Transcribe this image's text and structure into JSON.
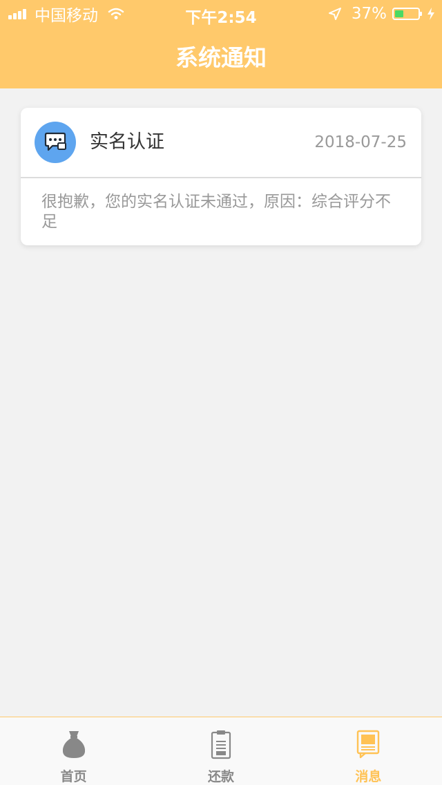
{
  "status_bar": {
    "carrier": "中国移动",
    "time": "下午2:54",
    "battery_percent": "37%",
    "battery_level": 0.37,
    "signal_bars": 4
  },
  "header": {
    "title": "系统通知"
  },
  "notifications": [
    {
      "icon": "message-icon",
      "title": "实名认证",
      "date": "2018-07-25",
      "body": "很抱歉，您的实名认证未通过，原因：综合评分不足"
    }
  ],
  "tabbar": {
    "items": [
      {
        "label": "首页",
        "icon": "money-bag-icon",
        "active": false
      },
      {
        "label": "还款",
        "icon": "clipboard-icon",
        "active": false
      },
      {
        "label": "消息",
        "icon": "message-book-icon",
        "active": true
      }
    ]
  },
  "colors": {
    "accent": "#ffc96b",
    "active_tab": "#ffc254",
    "avatar": "#5ea5ef",
    "battery_fill": "#4cd964",
    "inactive_tab": "#888888"
  }
}
